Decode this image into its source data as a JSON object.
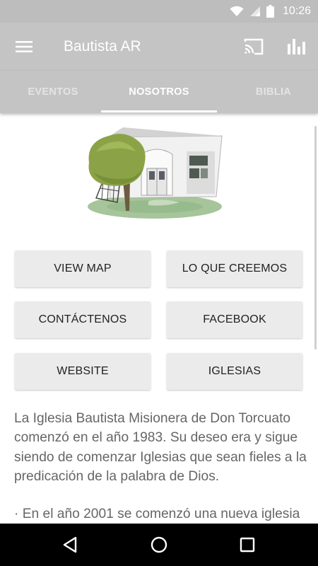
{
  "status_bar": {
    "time": "10:26",
    "icons": [
      "wifi-icon",
      "signal-icon",
      "battery-icon"
    ]
  },
  "app_bar": {
    "title": "Bautista AR",
    "icons": [
      "menu-icon",
      "cast-icon",
      "stats-icon"
    ]
  },
  "tabs": [
    {
      "label": "EVENTOS",
      "active": false
    },
    {
      "label": "NOSOTROS",
      "active": true
    },
    {
      "label": "BIBLIA",
      "active": false
    }
  ],
  "buttons": [
    {
      "label": "VIEW MAP"
    },
    {
      "label": "LO QUE CREEMOS"
    },
    {
      "label": "CONTÁCTENOS"
    },
    {
      "label": "FACEBOOK"
    },
    {
      "label": "WEBSITE"
    },
    {
      "label": "IGLESIAS"
    }
  ],
  "description": {
    "paragraph_1": "La Iglesia Bautista Misionera de Don Torcuato comenzó en el año 1983. Su deseo era y sigue siendo de comenzar Iglesias que sean fieles a la predicación de la palabra de Dios.",
    "paragraph_2": "· En el año 2001 se comenzó una nueva iglesia"
  },
  "nav_bar": {
    "icons": [
      "back-icon",
      "home-icon",
      "recents-icon"
    ]
  },
  "colors": {
    "app_bar": "#c4c4c4",
    "status_bar": "#bdbdbd",
    "button_bg": "#ebebeb",
    "text": "#666666",
    "nav_bar": "#000000"
  }
}
